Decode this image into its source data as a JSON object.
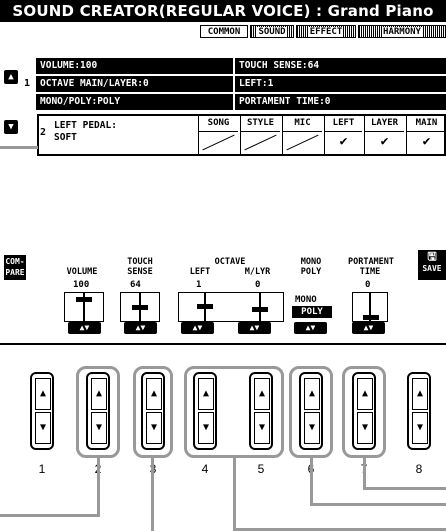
{
  "title": "SOUND CREATOR(REGULAR VOICE) : Grand Piano",
  "tabs": [
    {
      "label": "COMMON",
      "state": "active"
    },
    {
      "label": "SOUND",
      "state": "inactive"
    },
    {
      "label": "EFFECT",
      "state": "inactive"
    },
    {
      "label": "HARMONY",
      "state": "inactive"
    }
  ],
  "row1": {
    "num": "1",
    "volume": "VOLUME:100",
    "touch_sense": "TOUCH SENSE:64",
    "octave": "OCTAVE MAIN/LAYER:0",
    "left": "LEFT:1",
    "mono_poly": "MONO/POLY:POLY",
    "portament": "PORTAMENT TIME:0"
  },
  "row2": {
    "num": "2",
    "left_pedal_label": "LEFT PEDAL:",
    "left_pedal_value": "SOFT",
    "parts": [
      "SONG",
      "STYLE",
      "MIC",
      "LEFT",
      "LAYER",
      "MAIN"
    ],
    "checked": [
      false,
      false,
      false,
      true,
      true,
      true
    ]
  },
  "side_icons": [
    "up-arrow-icon",
    "down-arrow-icon"
  ],
  "compare": "COM-\nPARE",
  "save": "SAVE",
  "sliders": {
    "volume": {
      "label": "VOLUME",
      "value": "100"
    },
    "touch": {
      "label_top": "TOUCH",
      "label": "SENSE",
      "value": "64"
    },
    "octave_group": "OCTAVE",
    "octave_left": {
      "label": "LEFT",
      "value": "1"
    },
    "octave_mlyr": {
      "label": "M/LYR",
      "value": "0"
    },
    "mono_top": "MONO",
    "poly": {
      "label": "POLY",
      "mono": "MONO",
      "poly": "POLY"
    },
    "portament_top": "PORTAMENT",
    "time": {
      "label": "TIME",
      "value": "0"
    }
  },
  "button_numbers": [
    "1",
    "2",
    "3",
    "4",
    "5",
    "6",
    "7",
    "8"
  ]
}
